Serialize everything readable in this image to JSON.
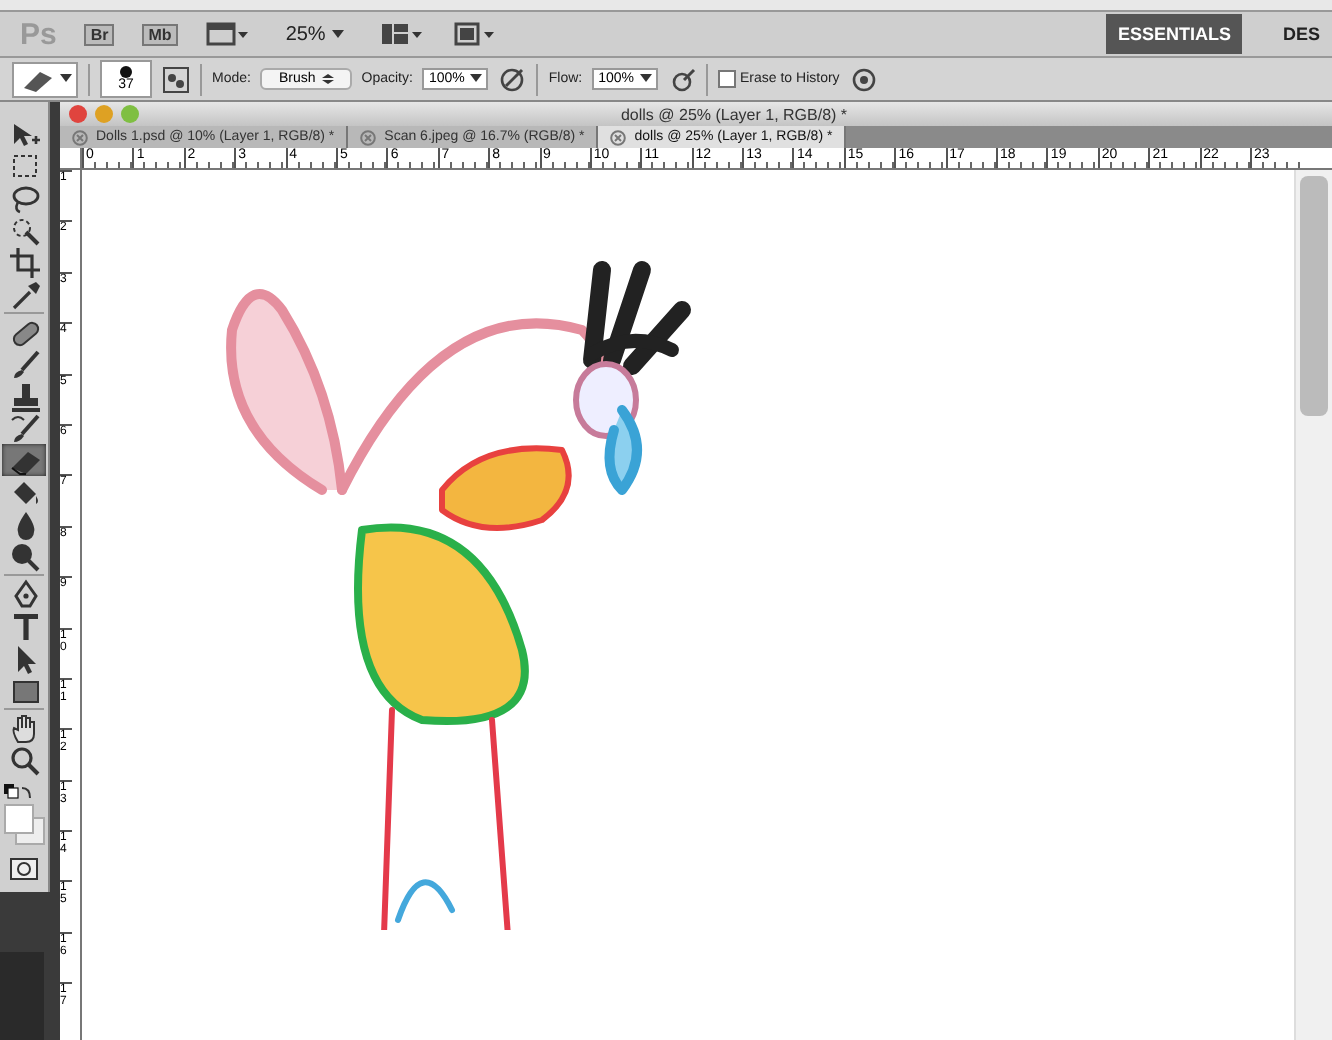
{
  "app_bar": {
    "logo": "Ps",
    "buttons": [
      "Br",
      "Mb"
    ],
    "zoom": "25%",
    "workspaces": [
      {
        "label": "ESSENTIALS",
        "selected": true
      },
      {
        "label": "DES",
        "selected": false
      }
    ]
  },
  "options_bar": {
    "brush_size": "37",
    "mode_label": "Mode:",
    "mode": "Brush",
    "opacity_label": "Opacity:",
    "opacity": "100%",
    "flow_label": "Flow:",
    "flow": "100%",
    "erase_to_history": {
      "label": "Erase to History",
      "checked": false
    }
  },
  "tools": [
    {
      "kind": "move",
      "selected": false
    },
    {
      "kind": "marquee",
      "selected": false
    },
    {
      "kind": "lasso",
      "selected": false
    },
    {
      "kind": "quick-select",
      "selected": false
    },
    {
      "kind": "crop",
      "selected": false
    },
    {
      "kind": "eyedropper",
      "selected": false
    },
    {
      "kind": "healing",
      "selected": false
    },
    {
      "kind": "brush",
      "selected": false
    },
    {
      "kind": "stamp",
      "selected": false
    },
    {
      "kind": "history-brush",
      "selected": false
    },
    {
      "kind": "eraser",
      "selected": true
    },
    {
      "kind": "bucket",
      "selected": false
    },
    {
      "kind": "blur",
      "selected": false
    },
    {
      "kind": "dodge",
      "selected": false
    },
    {
      "kind": "pen",
      "selected": false
    },
    {
      "kind": "type",
      "selected": false
    },
    {
      "kind": "path-select",
      "selected": false
    },
    {
      "kind": "shape",
      "selected": false
    },
    {
      "kind": "hand",
      "selected": false
    },
    {
      "kind": "zoom",
      "selected": false
    }
  ],
  "document": {
    "title": "dolls @ 25% (Layer 1, RGB/8) *",
    "tabs": [
      {
        "label": "Dolls 1.psd @ 10% (Layer 1, RGB/8) *",
        "selected": false
      },
      {
        "label": "Scan 6.jpeg @ 16.7% (RGB/8) *",
        "selected": false
      },
      {
        "label": "dolls @ 25% (Layer 1, RGB/8) *",
        "selected": true
      }
    ],
    "ruler_h": [
      "0",
      "1",
      "2",
      "3",
      "4",
      "5",
      "6",
      "7",
      "8",
      "9",
      "10",
      "11",
      "12",
      "13",
      "14",
      "15",
      "16",
      "17",
      "18",
      "19",
      "20",
      "21",
      "22",
      "23"
    ],
    "ruler_v": [
      "1",
      "2",
      "3",
      "4",
      "5",
      "6",
      "7",
      "8",
      "9",
      "10",
      "11",
      "12",
      "13",
      "14",
      "15",
      "16",
      "17"
    ]
  }
}
